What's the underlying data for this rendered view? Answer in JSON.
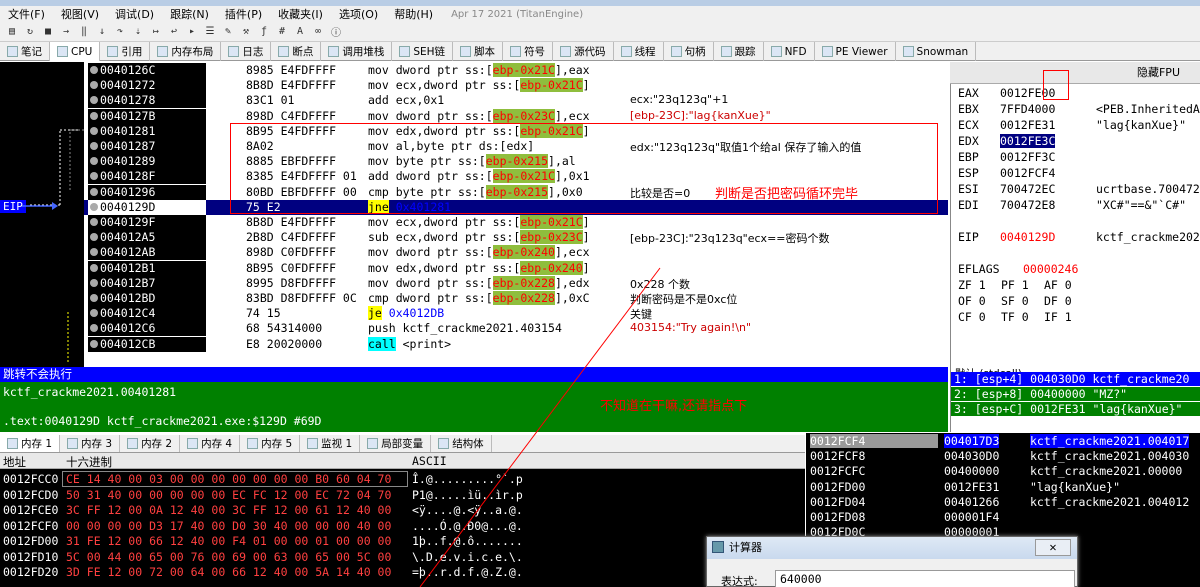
{
  "title_meta": "Apr 17 2021 (TitanEngine)",
  "menu": [
    "文件(F)",
    "视图(V)",
    "调试(D)",
    "跟踪(N)",
    "插件(P)",
    "收藏夹(I)",
    "选项(O)",
    "帮助(H)"
  ],
  "toolbar_icons": [
    "folder-icon",
    "refresh-icon",
    "stop-icon",
    "play-icon",
    "pause-icon",
    "step-into-icon",
    "step-over-icon",
    "trace-icon",
    "run-to-icon",
    "return-icon",
    "run-user-icon",
    "list-icon",
    "pen-icon",
    "tool-icon",
    "fx-icon",
    "hash-icon",
    "a-icon",
    "link-icon",
    "info-icon"
  ],
  "tabs": [
    {
      "label": "笔记",
      "icon": "note-icon"
    },
    {
      "label": "CPU",
      "icon": "cpu-icon",
      "active": true
    },
    {
      "label": "引用",
      "icon": "ref-icon"
    },
    {
      "label": "内存布局",
      "icon": "memory-icon"
    },
    {
      "label": "日志",
      "icon": "log-icon"
    },
    {
      "label": "断点",
      "icon": "breakpoint-icon"
    },
    {
      "label": "调用堆栈",
      "icon": "callstack-icon"
    },
    {
      "label": "SEH链",
      "icon": "seh-icon"
    },
    {
      "label": "脚本",
      "icon": "script-icon"
    },
    {
      "label": "符号",
      "icon": "symbol-icon"
    },
    {
      "label": "源代码",
      "icon": "source-icon"
    },
    {
      "label": "线程",
      "icon": "thread-icon"
    },
    {
      "label": "句柄",
      "icon": "handle-icon"
    },
    {
      "label": "跟踪",
      "icon": "trace-tab-icon"
    },
    {
      "label": "NFD",
      "icon": "nfd-icon"
    },
    {
      "label": "PE Viewer",
      "icon": "pe-icon"
    },
    {
      "label": "Snowman",
      "icon": "snowman-icon"
    }
  ],
  "eip_label": "EIP",
  "disasm": [
    {
      "addr": "0040126C",
      "bytes": "8985 E4FDFFFF",
      "mn": "mov",
      "pre": "dword ptr ss:[",
      "reg": "ebp-0x21C",
      "post": "],eax",
      "cmt": ""
    },
    {
      "addr": "00401272",
      "bytes": "8B8D E4FDFFFF",
      "mn": "mov",
      "pre": "ecx,dword ptr ss:[",
      "reg": "ebp-0x21C",
      "post": "]",
      "cmt": ""
    },
    {
      "addr": "00401278",
      "bytes": "83C1 01",
      "mn": "add",
      "pre": "ecx,",
      "reg": "",
      "post": "0x1",
      "cmt": "ecx:\"23q123q\"+1"
    },
    {
      "addr": "0040127B",
      "bytes": "898D C4FDFFFF",
      "mn": "mov",
      "pre": "dword ptr ss:[",
      "reg": "ebp-0x23C",
      "post": "],ecx",
      "cmt": "[ebp-23C]:\"lag{kanXue}\"",
      "cmt_red": true
    },
    {
      "addr": "00401281",
      "bytes": "8B95 E4FDFFFF",
      "mn": "mov",
      "pre": "edx,dword ptr ss:[",
      "reg": "ebp-0x21C",
      "post": "]",
      "cmt": ""
    },
    {
      "addr": "00401287",
      "bytes": "8A02",
      "mn": "mov",
      "pre": "al,byte ptr ds:[edx]",
      "reg": "",
      "post": "",
      "cmt": "edx:\"123q123q\"取值1个给al 保存了输入的值"
    },
    {
      "addr": "00401289",
      "bytes": "8885 EBFDFFFF",
      "mn": "mov",
      "pre": "byte ptr ss:[",
      "reg": "ebp-0x215",
      "post": "],al",
      "cmt": ""
    },
    {
      "addr": "0040128F",
      "bytes": "8385 E4FDFFFF 01",
      "mn": "add",
      "pre": "dword ptr ss:[",
      "reg": "ebp-0x21C",
      "post": "],0x1",
      "cmt": ""
    },
    {
      "addr": "00401296",
      "bytes": "80BD EBFDFFFF 00",
      "mn": "cmp",
      "pre": "byte ptr ss:[",
      "reg": "ebp-0x215",
      "post": "],0x0",
      "cmt": "比较是否=0"
    },
    {
      "addr": "0040129D",
      "bytes": "75 E2",
      "mn": "jne",
      "pre": "0x401281",
      "reg": "",
      "post": "",
      "cmt": "",
      "current": true
    },
    {
      "addr": "0040129F",
      "bytes": "8B8D E4FDFFFF",
      "mn": "mov",
      "pre": "ecx,dword ptr ss:[",
      "reg": "ebp-0x21C",
      "post": "]",
      "cmt": ""
    },
    {
      "addr": "004012A5",
      "bytes": "2B8D C4FDFFFF",
      "mn": "sub",
      "pre": "ecx,dword ptr ss:[",
      "reg": "ebp-0x23C",
      "post": "]",
      "cmt": "[ebp-23C]:\"23q123q\"ecx==密码个数"
    },
    {
      "addr": "004012AB",
      "bytes": "898D C0FDFFFF",
      "mn": "mov",
      "pre": "dword ptr ss:[",
      "reg": "ebp-0x240",
      "post": "],ecx",
      "cmt": ""
    },
    {
      "addr": "004012B1",
      "bytes": "8B95 C0FDFFFF",
      "mn": "mov",
      "pre": "edx,dword ptr ss:[",
      "reg": "ebp-0x240",
      "post": "]",
      "cmt": ""
    },
    {
      "addr": "004012B7",
      "bytes": "8995 D8FDFFFF",
      "mn": "mov",
      "pre": "dword ptr ss:[",
      "reg": "ebp-0x228",
      "post": "],edx",
      "cmt": "0x228 个数"
    },
    {
      "addr": "004012BD",
      "bytes": "83BD D8FDFFFF 0C",
      "mn": "cmp",
      "pre": "dword ptr ss:[",
      "reg": "ebp-0x228",
      "post": "],0xC",
      "cmt": "判断密码是不是0xc位"
    },
    {
      "addr": "004012C4",
      "bytes": "74 15",
      "mn": "je",
      "pre": "0x4012DB",
      "reg": "",
      "post": "",
      "cmt": "关键"
    },
    {
      "addr": "004012C6",
      "bytes": "68 54314000",
      "mn": "push",
      "pre": "kctf_crackme2021.403154",
      "reg": "",
      "post": "",
      "cmt": "403154:\"Try again!\\n\"",
      "cmt_red": true
    },
    {
      "addr": "004012CB",
      "bytes": "E8 20020000",
      "mn": "call",
      "pre": "<print>",
      "reg": "",
      "post": "",
      "cmt": ""
    }
  ],
  "annotations": {
    "loop": "判断是否把密码循环完毕",
    "question": "不知道在干嘛,还请指点下"
  },
  "registers_header": "隐藏FPU",
  "registers": [
    {
      "name": "EAX",
      "value": "0012FE00",
      "cmt": ""
    },
    {
      "name": "EBX",
      "value": "7FFD4000",
      "cmt": "<PEB.InheritedA"
    },
    {
      "name": "ECX",
      "value": "0012FE31",
      "cmt": "\"lag{kanXue}\""
    },
    {
      "name": "EDX",
      "value": "0012FE3C",
      "cmt": "",
      "selected": true
    },
    {
      "name": "EBP",
      "value": "0012FF3C",
      "cmt": ""
    },
    {
      "name": "ESP",
      "value": "0012FCF4",
      "cmt": ""
    },
    {
      "name": "ESI",
      "value": "700472EC",
      "cmt": "ucrtbase.700472"
    },
    {
      "name": "EDI",
      "value": "700472E8",
      "cmt": "\"XC#\"==&\"`C#\""
    },
    {
      "name": "EIP",
      "value": "0040129D",
      "cmt": "kctf_crackme202",
      "red": true
    }
  ],
  "eflags": {
    "label": "EFLAGS",
    "value": "00000246"
  },
  "flags": [
    [
      "ZF 1",
      "PF 1",
      "AF 0"
    ],
    [
      "OF 0",
      "SF 0",
      "DF 0"
    ],
    [
      "CF 0",
      "TF 0",
      "IF 1"
    ]
  ],
  "info": {
    "status": "跳转不会执行",
    "line1": "kctf_crackme2021.00401281",
    "line2": ".text:0040129D kctf_crackme2021.exe:$129D #69D"
  },
  "callconv": {
    "header": "默认 (stdcall)",
    "rows": [
      "1: [esp+4] 004030D0 kctf_crackme20",
      "2: [esp+8] 00400000 \"MZ?\"",
      "3: [esp+C] 0012FE31 \"lag{kanXue}\""
    ]
  },
  "dump_tabs": [
    {
      "label": "内存 1",
      "icon": "mem1-icon",
      "active": true
    },
    {
      "label": "内存 3",
      "icon": "mem3-icon"
    },
    {
      "label": "内存 2",
      "icon": "mem2-icon"
    },
    {
      "label": "内存 4",
      "icon": "mem4-icon"
    },
    {
      "label": "内存 5",
      "icon": "mem5-icon"
    },
    {
      "label": "监视 1",
      "icon": "watch-icon"
    },
    {
      "label": "局部变量",
      "icon": "locals-icon"
    },
    {
      "label": "结构体",
      "icon": "struct-icon"
    }
  ],
  "dump_header": {
    "addr": "地址",
    "hex": "十六进制",
    "ascii": "ASCII"
  },
  "dump": [
    {
      "addr": "0012FCC0",
      "hex": "CE 14 40 00 03 00 00 00 00 00 00 00 B0 60 04 70",
      "ascii": "Î.@.........°`.p"
    },
    {
      "addr": "0012FCD0",
      "hex": "50 31 40 00 00 00 00 00 EC FC 12 00 EC 72 04 70",
      "ascii": "P1@.....ìü..ìr.p"
    },
    {
      "addr": "0012FCE0",
      "hex": "3C FF 12 00 0A 12 40 00 3C FF 12 00 61 12 40 00",
      "ascii": "<ÿ....@.<ÿ..a.@."
    },
    {
      "addr": "0012FCF0",
      "hex": "00 00 00 00 D3 17 40 00 D0 30 40 00 00 00 40 00",
      "ascii": "....Ó.@.Ð0@...@."
    },
    {
      "addr": "0012FD00",
      "hex": "31 FE 12 00 66 12 40 00 F4 01 00 00 01 00 00 00",
      "ascii": "1þ..f.@.ô......."
    },
    {
      "addr": "0012FD10",
      "hex": "5C 00 44 00 65 00 76 00 69 00 63 00 65 00 5C 00",
      "ascii": "\\.D.e.v.i.c.e.\\."
    },
    {
      "addr": "0012FD20",
      "hex": "3D FE 12 00 72 00 64 00 66 12 40 00 5A 14 40 00",
      "ascii": "=þ..r.d.f.@.Z.@."
    }
  ],
  "stack": [
    {
      "addr": "0012FCF4",
      "val": "004017D3",
      "cmt": "kctf_crackme2021.004017",
      "sel": true
    },
    {
      "addr": "0012FCF8",
      "val": "004030D0",
      "cmt": "kctf_crackme2021.004030"
    },
    {
      "addr": "0012FCFC",
      "val": "00400000",
      "cmt": "kctf_crackme2021.00000"
    },
    {
      "addr": "0012FD00",
      "val": "0012FE31",
      "cmt": "\"lag{kanXue}\""
    },
    {
      "addr": "0012FD04",
      "val": "00401266",
      "cmt": "kctf_crackme2021.004012"
    },
    {
      "addr": "0012FD08",
      "val": "000001F4",
      "cmt": ""
    },
    {
      "addr": "0012FD0C",
      "val": "00000001",
      "cmt": ""
    }
  ],
  "calc": {
    "title": "计算器",
    "label": "表达式:",
    "value": "640000",
    "close": "✕"
  }
}
